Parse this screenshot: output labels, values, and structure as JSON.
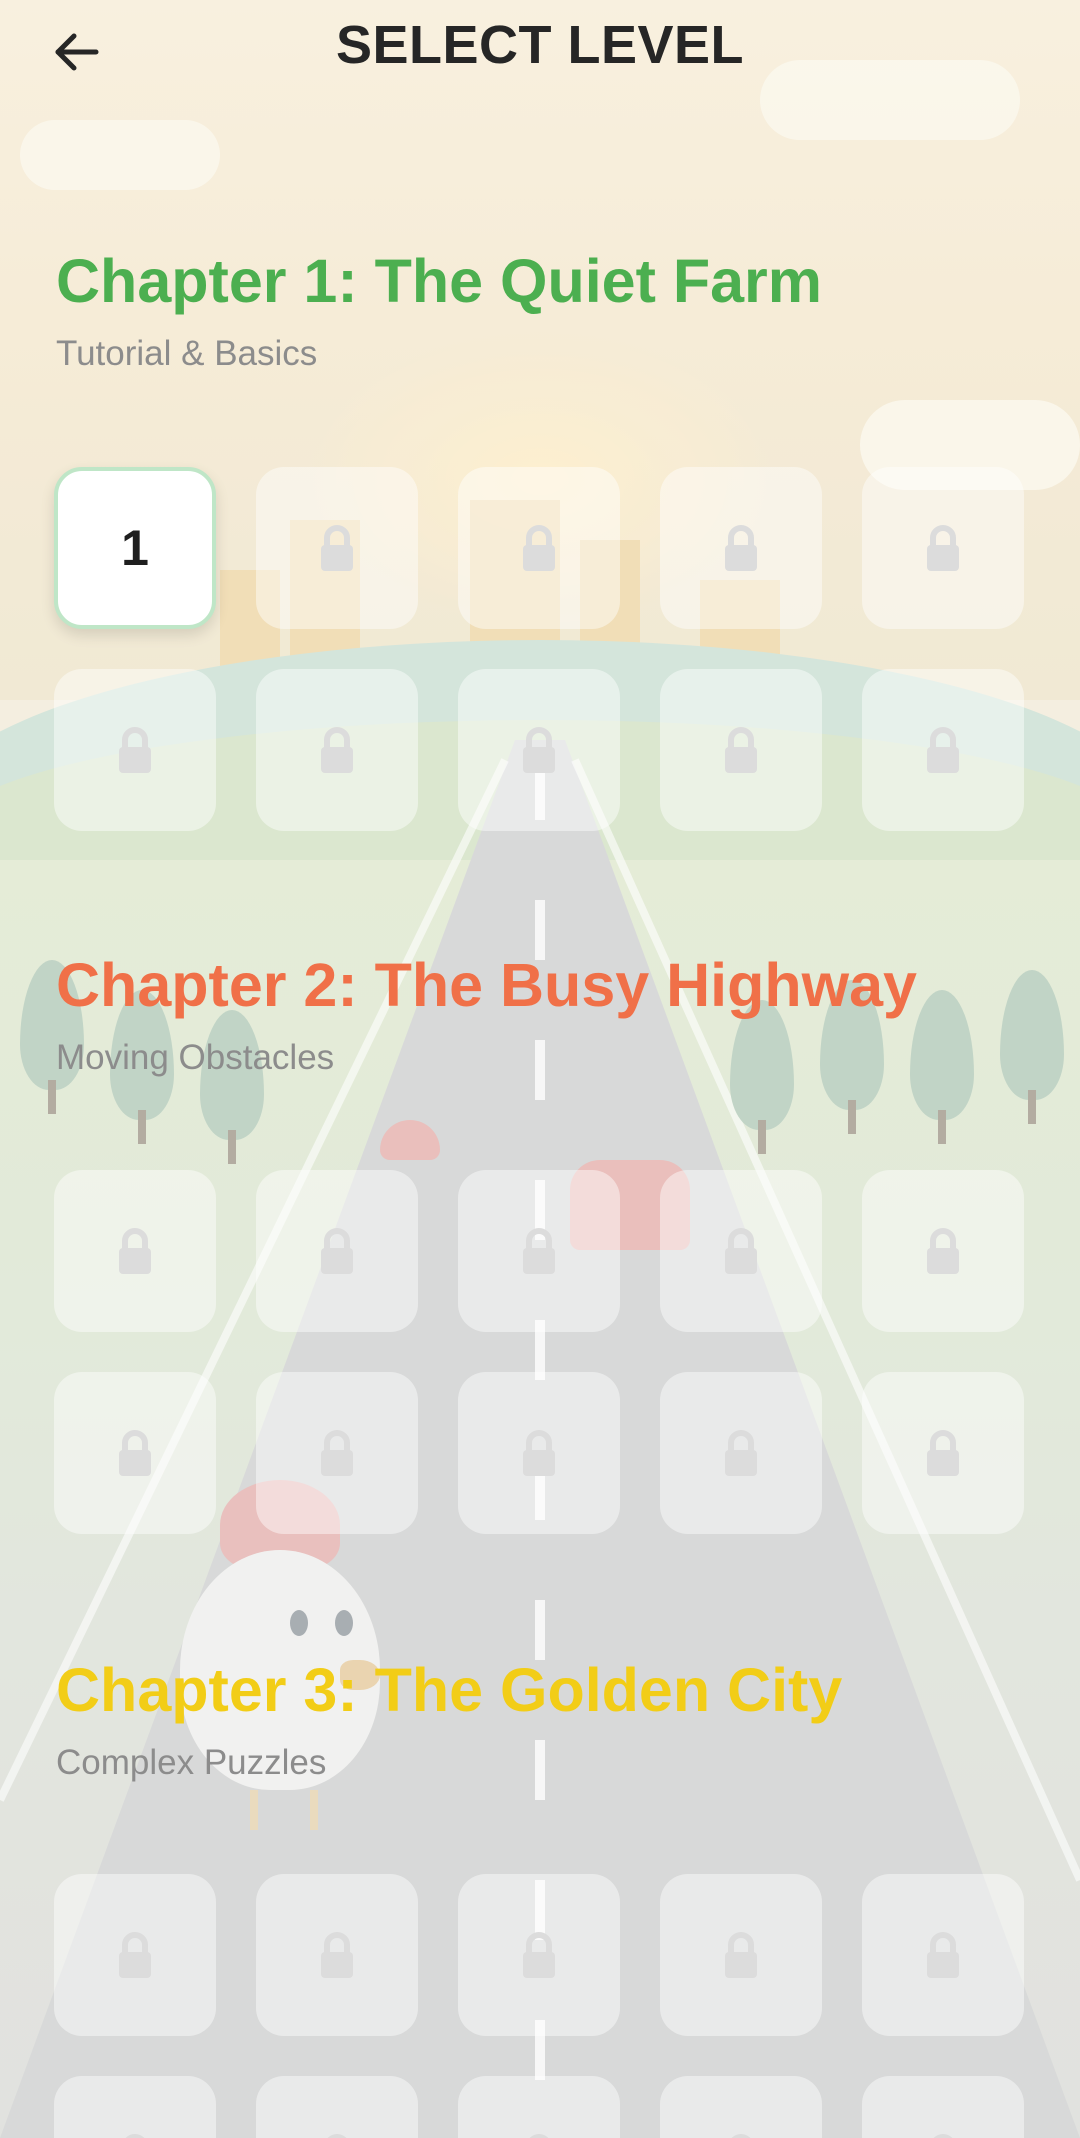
{
  "header": {
    "title": "SELECT LEVEL"
  },
  "chapters": [
    {
      "title": "Chapter 1: The Quiet Farm",
      "subtitle": "Tutorial & Basics",
      "color": "#4caf50",
      "levels": [
        {
          "label": "1",
          "locked": false
        },
        {
          "locked": true
        },
        {
          "locked": true
        },
        {
          "locked": true
        },
        {
          "locked": true
        },
        {
          "locked": true
        },
        {
          "locked": true
        },
        {
          "locked": true
        },
        {
          "locked": true
        },
        {
          "locked": true
        }
      ]
    },
    {
      "title": "Chapter 2: The Busy Highway",
      "subtitle": "Moving Obstacles",
      "color": "#f07048",
      "levels": [
        {
          "locked": true
        },
        {
          "locked": true
        },
        {
          "locked": true
        },
        {
          "locked": true
        },
        {
          "locked": true
        },
        {
          "locked": true
        },
        {
          "locked": true
        },
        {
          "locked": true
        },
        {
          "locked": true
        },
        {
          "locked": true
        }
      ]
    },
    {
      "title": "Chapter 3: The Golden City",
      "subtitle": "Complex Puzzles",
      "color": "#f2cd17",
      "levels": [
        {
          "locked": true
        },
        {
          "locked": true
        },
        {
          "locked": true
        },
        {
          "locked": true
        },
        {
          "locked": true
        },
        {
          "locked": true
        },
        {
          "locked": true
        },
        {
          "locked": true
        },
        {
          "locked": true
        },
        {
          "locked": true
        }
      ]
    }
  ],
  "icons": {
    "back": "arrow-left-icon",
    "lock": "lock-icon"
  }
}
